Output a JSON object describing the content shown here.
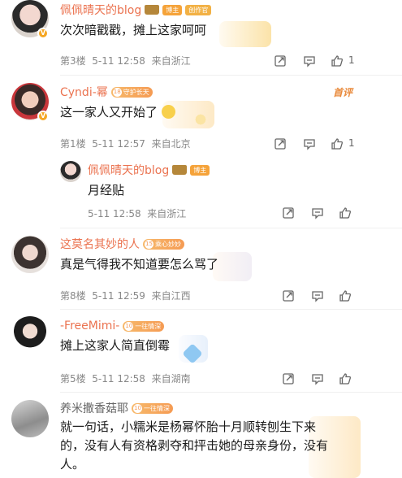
{
  "comments": [
    {
      "user": "佩佩晴天的blog",
      "badges": [
        "博主",
        "创作官"
      ],
      "text": "次次暗戳戳，摊上这家呵呵",
      "floor": "第3楼",
      "time": "5-11 12:58",
      "location": "来自浙江",
      "likes": "1"
    },
    {
      "user": "Cyndi-幂",
      "level": "18",
      "fan_badge": "守护长天",
      "author_mark": "首评",
      "text": "这一家人又开始了",
      "floor": "第1楼",
      "time": "5-11 12:57",
      "location": "来自北京",
      "likes": "1",
      "reply": {
        "user": "佩佩晴天的blog",
        "badge": "博主",
        "text": "月经贴",
        "time": "5-11 12:58",
        "location": "来自浙江"
      }
    },
    {
      "user": "这莫名其妙的人",
      "level": "15",
      "fan_badge": "乘心妙妙",
      "text": "真是气得我不知道要怎么骂了",
      "floor": "第8楼",
      "time": "5-11 12:59",
      "location": "来自江西"
    },
    {
      "user": "-FreeMimi-",
      "level": "10",
      "fan_badge": "一往情深",
      "text": "摊上这家人简直倒霉",
      "floor": "第5楼",
      "time": "5-11 12:58",
      "location": "来自湖南"
    },
    {
      "user": "养米撒香菇耶",
      "level": "10",
      "fan_badge": "一往情深",
      "text_lines": [
        "就一句话，小糯米是杨幂怀胎十月顺转刨生下来",
        "的，没有人有资格剥夺和抨击她的母亲身份，没有",
        "人。"
      ]
    }
  ],
  "colors": {
    "username": "#eb7350",
    "meta": "#888888",
    "bubble": "#fdeed7"
  },
  "icons": [
    "share-icon",
    "comment-icon",
    "like-icon",
    "verified-icon"
  ]
}
